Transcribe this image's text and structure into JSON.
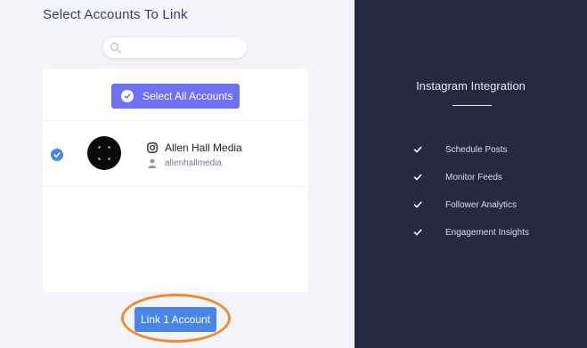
{
  "header": {
    "title": "Select Accounts To Link"
  },
  "search": {
    "placeholder": ""
  },
  "select_all": {
    "label": "Select All Accounts"
  },
  "accounts": [
    {
      "name": "Allen Hall Media",
      "handle": "allenhallmedia",
      "platform_icon": "instagram-icon",
      "selected": true
    }
  ],
  "footer": {
    "link_button_label": "Link 1 Account"
  },
  "integration": {
    "title": "Instagram Integration",
    "features": [
      "Schedule Posts",
      "Monitor Feeds",
      "Follower Analytics",
      "Engagement Insights"
    ]
  },
  "colors": {
    "accent_primary": "#6f71f5",
    "accent_blue": "#4a86e8",
    "sidebar_bg": "#262a3f",
    "highlight_ring": "#f28c2a"
  }
}
